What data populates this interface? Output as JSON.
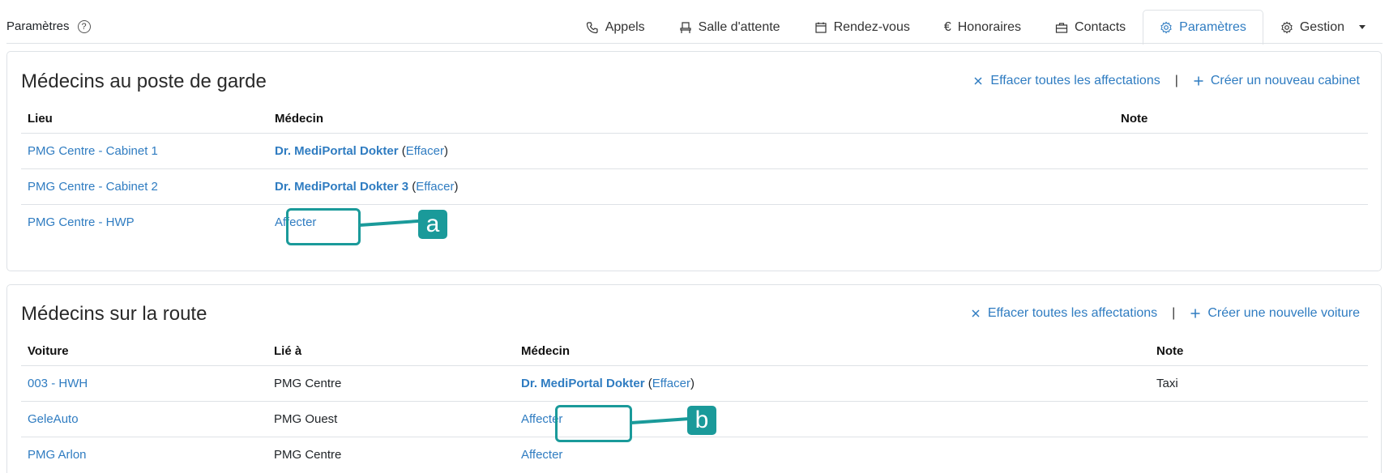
{
  "header": {
    "title": "Paramètres",
    "help_icon": "question-circle-icon"
  },
  "tabs": [
    {
      "label": "Appels",
      "icon": "phone-icon"
    },
    {
      "label": "Salle d'attente",
      "icon": "chair-icon"
    },
    {
      "label": "Rendez-vous",
      "icon": "calendar-icon"
    },
    {
      "label": "Honoraires",
      "icon": "euro-icon"
    },
    {
      "label": "Contacts",
      "icon": "briefcase-icon"
    },
    {
      "label": "Paramètres",
      "icon": "gear-icon",
      "active": true
    },
    {
      "label": "Gestion",
      "icon": "gear-icon",
      "dropdown": true
    }
  ],
  "garde": {
    "title": "Médecins au poste de garde",
    "clear_all": "Effacer toutes les affectations",
    "separator": "|",
    "create": "Créer un nouveau cabinet",
    "columns": {
      "lieu": "Lieu",
      "medecin": "Médecin",
      "note": "Note"
    },
    "rows": [
      {
        "lieu": "PMG Centre - Cabinet 1",
        "medecin": "Dr. MediPortal Dokter",
        "effacer": "Effacer",
        "note": ""
      },
      {
        "lieu": "PMG Centre - Cabinet 2",
        "medecin": "Dr. MediPortal Dokter 3",
        "effacer": "Effacer",
        "note": ""
      },
      {
        "lieu": "PMG Centre - HWP",
        "affecter": "Affecter",
        "note": ""
      }
    ]
  },
  "route": {
    "title": "Médecins sur la route",
    "clear_all": "Effacer toutes les affectations",
    "separator": "|",
    "create": "Créer une nouvelle voiture",
    "columns": {
      "voiture": "Voiture",
      "lie_a": "Lié à",
      "medecin": "Médecin",
      "note": "Note"
    },
    "rows": [
      {
        "voiture": "003 - HWH",
        "lie_a": "PMG Centre",
        "medecin": "Dr. MediPortal Dokter",
        "effacer": "Effacer",
        "note": "Taxi"
      },
      {
        "voiture": "GeleAuto",
        "lie_a": "PMG Ouest",
        "affecter": "Affecter",
        "note": ""
      },
      {
        "voiture": "PMG Arlon",
        "lie_a": "PMG Centre",
        "affecter": "Affecter",
        "note": ""
      }
    ]
  },
  "callouts": {
    "a": "a",
    "b": "b"
  },
  "colors": {
    "link": "#2f7cc1",
    "callout": "#1a9a9a"
  }
}
